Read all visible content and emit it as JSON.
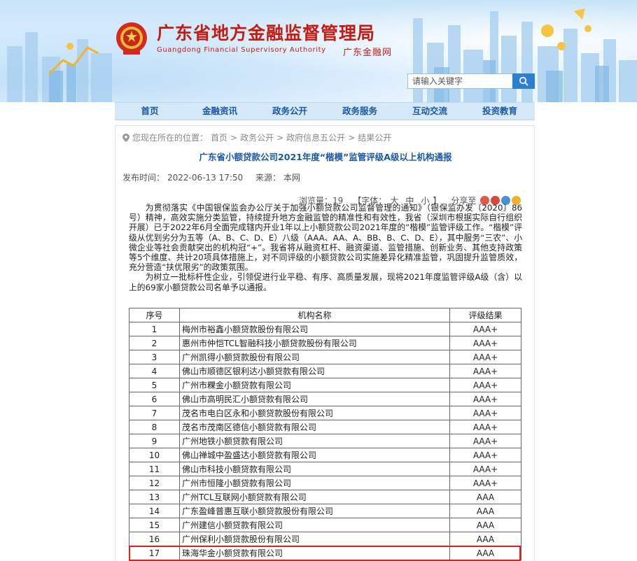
{
  "header": {
    "title": "广东省地方金融监督管理局",
    "subtitle": "Guangdong Financial Supervisory Authority",
    "short_name": "广东金融网",
    "emblem_icon": "national-emblem-icon",
    "brand_color": "#c41c12"
  },
  "search": {
    "placeholder": "请输入关键字",
    "button_icon": "search-icon"
  },
  "nav": {
    "items": [
      "首页",
      "金融资讯",
      "政务公开",
      "政务服务",
      "互动交流",
      "投资教育"
    ]
  },
  "breadcrumb": {
    "prefix": "您现在所在的位置：",
    "items": [
      "首页",
      "政务公开",
      "政府信息五公开",
      "结果公开"
    ],
    "separator": ">"
  },
  "article": {
    "title": "广东省小额贷款公司2021年度“楷模”监管评级A级以上机构通报",
    "publish_label": "发布时间：",
    "publish_time": "2022-06-13 17:50",
    "source_label": "来源：",
    "source": "本网",
    "views_label": "浏览量：",
    "views": "19",
    "font_label": "【字体：",
    "font_sizes": [
      "大",
      "中",
      "小"
    ],
    "font_close": "】",
    "share_label": "分享至",
    "paragraph1": "为贯彻落实《中国银保监会办公厅关于加强小额贷款公司监督管理的通知》（银保监办发〔2020〕86号）精神，高效实施分类监管，持续提升地方金融监管的精准性和有效性，我省（深圳市根据实际自行组织开展）已于2022年6月全面完成辖内开业1年以上小额贷款公司2021年度的“楷模”监管评级工作。“楷模”评级从优到劣分为五等（A、B、C、D、E）八级（AAA、AA、A、BB、B、C、D、E），其中服务“三农”、小微企业等社会贡献突出的机构冠“+”。我省将从融资杠杆、融资渠道、监管措施、创新业务、其他支持政策等5个维度、共计20项具体措施上，对不同评级的小额贷款公司实施差异化精准监管，巩固提升监管质效，充分营造“扶优限劣”的政策氛围。",
    "paragraph2": "为树立一批标杆性企业，引领促进行业平稳、有序、高质量发展，现将2021年度监管评级A级（含）以上的69家小额贷款公司名单予以通报。"
  },
  "table": {
    "headers": [
      "序号",
      "机构名称",
      "评级结果"
    ],
    "rows": [
      [
        "1",
        "梅州市裕鑫小额贷款股份有限公司",
        "AAA+"
      ],
      [
        "2",
        "惠州市仲恺TCL智融科技小额贷款股份有限公司",
        "AAA+"
      ],
      [
        "3",
        "广州凯得小额贷款股份有限公司",
        "AAA+"
      ],
      [
        "4",
        "佛山市顺德区银利达小额贷款有限公司",
        "AAA+"
      ],
      [
        "5",
        "广州市粿金小额贷款有限公司",
        "AAA+"
      ],
      [
        "6",
        "佛山市高明民汇小额贷款有限公司",
        "AAA+"
      ],
      [
        "7",
        "茂名市电白区永和小额贷款股份有限公司",
        "AAA+"
      ],
      [
        "8",
        "茂名市茂南区德信小额贷款有限公司",
        "AAA+"
      ],
      [
        "9",
        "广州地铁小额贷款有限公司",
        "AAA+"
      ],
      [
        "10",
        "佛山禅城中盈盛达小额贷款有限公司",
        "AAA+"
      ],
      [
        "11",
        "佛山市科技小额贷款有限公司",
        "AAA+"
      ],
      [
        "12",
        "广州市恒隆小额贷款有限公司",
        "AAA+"
      ],
      [
        "13",
        "广州TCL互联网小额贷款有限公司",
        "AAA"
      ],
      [
        "14",
        "广东盈峰普惠互联小额贷款股份有限公司",
        "AAA"
      ],
      [
        "15",
        "广州建信小额贷款有限公司",
        "AAA"
      ],
      [
        "16",
        "广州保利小额贷款股份有限公司",
        "AAA"
      ],
      [
        "17",
        "珠海华金小额贷款有限公司",
        "AAA"
      ]
    ],
    "highlighted_row": "17",
    "highlight_color": "#e02020"
  }
}
